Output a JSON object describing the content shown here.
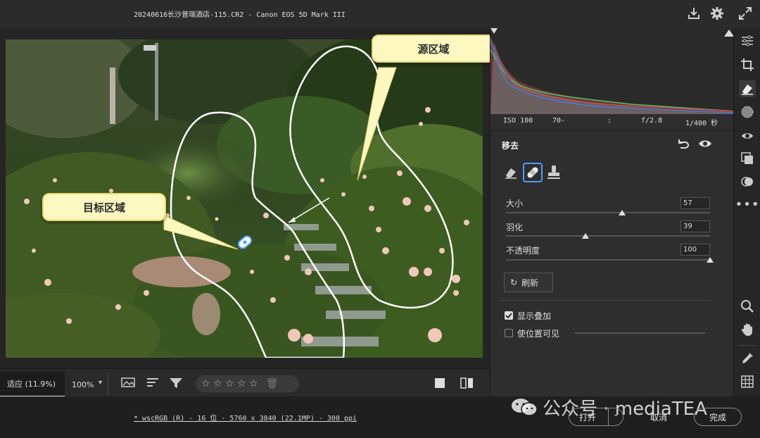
{
  "window": {
    "title": "20240616长沙普瑞酒店-115.CR2 -  Canon EOS 5D Mark III"
  },
  "callouts": {
    "source": "源区域",
    "target": "目标区域"
  },
  "exif": {
    "iso": "ISO 100",
    "focal": "70-",
    "sep": ":",
    "aperture": "f/2.8",
    "shutter": "1/400 秒"
  },
  "remove_panel": {
    "title": "移去",
    "sliders": [
      {
        "label": "大小",
        "value": "57",
        "fraction": 0.57
      },
      {
        "label": "羽化",
        "value": "39",
        "fraction": 0.39
      },
      {
        "label": "不透明度",
        "value": "100",
        "fraction": 1.0
      }
    ],
    "refresh_label": "刷新",
    "show_overlay_label": "显示叠加",
    "show_overlay_checked": true,
    "visualize_spots_label": "使位置可见",
    "visualize_spots_checked": false
  },
  "bottom_toolbar": {
    "zoom_fit": "适应 (11.9%)",
    "zoom_100": "100%",
    "rating_stars": "☆ ☆ ☆ ☆ ☆"
  },
  "status": {
    "file_info": "* wscRGB (R) - 16 位 - 5760 x 3840 (22.1MP) - 300 ppi",
    "open_label": "打开",
    "cancel_label": "取消",
    "done_label": "完成",
    "watermark": "公众号 · mediaTEA"
  },
  "colors": {
    "accent": "#4a9eff",
    "callout_bg": "#fdf7c0"
  },
  "icons": {
    "titlebar": [
      "save-icon",
      "gear-icon",
      "expand-icon"
    ],
    "rail": [
      "edit-sliders-icon",
      "crop-icon",
      "eraser-icon",
      "mask-icon",
      "redeye-icon",
      "presets-icon",
      "snapshots-icon",
      "more-icon",
      "zoom-icon",
      "hand-icon",
      "color-sampler-icon",
      "grid-icon"
    ]
  }
}
